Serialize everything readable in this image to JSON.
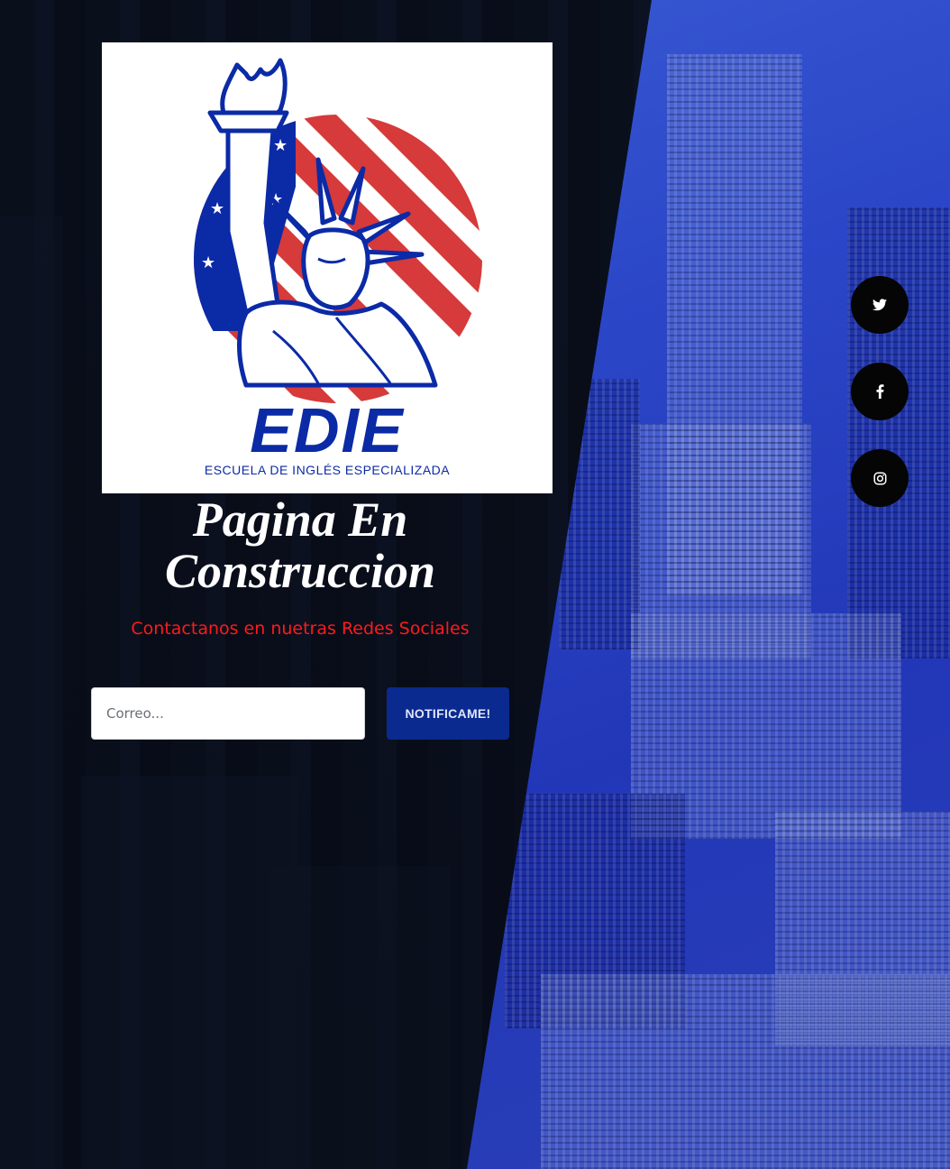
{
  "logo": {
    "brand": "EDIE",
    "tagline": "ESCUELA DE INGLÉS ESPECIALIZADA",
    "colors": {
      "blue": "#0b2aa6",
      "red": "#d63a3a"
    }
  },
  "hero": {
    "title_line1": "Pagina En",
    "title_line2": "Construccion",
    "subtitle": "Contactanos en nuetras Redes Sociales"
  },
  "signup": {
    "email_placeholder": "Correo...",
    "email_value": "",
    "submit_label": "NOTIFICAME!"
  },
  "social": [
    {
      "name": "twitter",
      "icon": "twitter-icon"
    },
    {
      "name": "facebook",
      "icon": "facebook-icon"
    },
    {
      "name": "instagram",
      "icon": "instagram-icon"
    }
  ],
  "theme": {
    "dark_bg": "#070b15",
    "blue_panel": "#2b47c8",
    "button_bg": "#0a2a8f",
    "subtitle_color": "#ff1a1a"
  }
}
